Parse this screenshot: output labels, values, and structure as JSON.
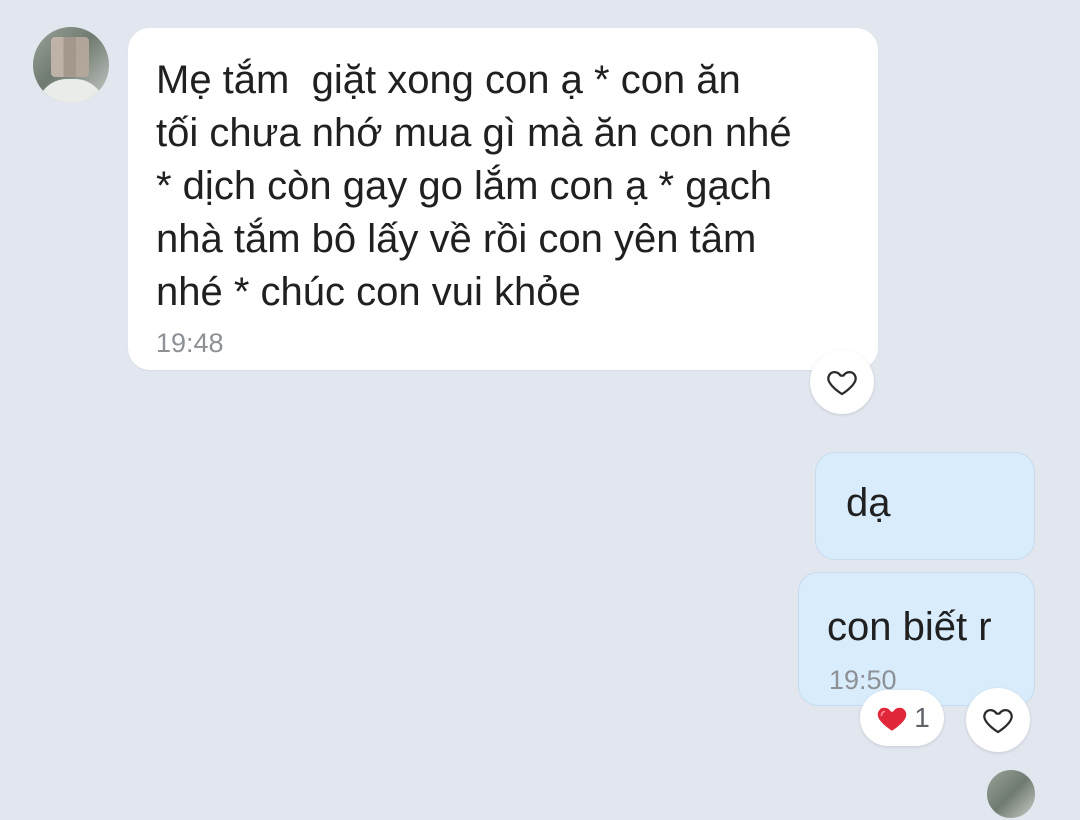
{
  "conversation": {
    "incoming_message": {
      "text": "Mẹ tắm  giặt xong con ạ * con ăn\ntối chưa nhớ mua gì mà ăn con nhé\n* dịch còn gay go lắm con ạ * gạch\nnhà tắm bô lấy về rồi con yên tâm\nnhé * chúc con vui khỏe",
      "time": "19:48",
      "react_icon": "heart-outline-icon"
    },
    "outgoing_messages": [
      {
        "text": "dạ"
      },
      {
        "text": "con biết r",
        "time": "19:50",
        "reaction": {
          "icon": "red-heart-icon",
          "count": "1"
        },
        "react_icon": "heart-outline-icon"
      }
    ]
  },
  "colors": {
    "background": "#e2e6ef",
    "incoming_bubble": "#ffffff",
    "outgoing_bubble": "#d8ecfc",
    "reaction_heart": "#e0283a"
  }
}
